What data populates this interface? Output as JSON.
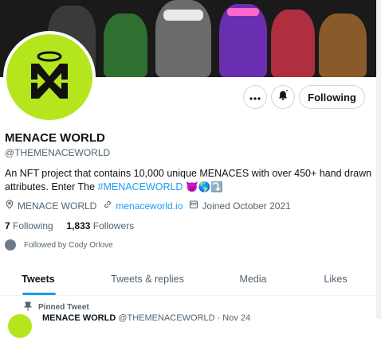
{
  "profile": {
    "name": "MENACE WORLD",
    "handle": "@THEMENACEWORLD",
    "bio_text": "An NFT project that contains 10,000 unique MENACES with over 450+ hand drawn attributes. Enter The ",
    "bio_hashtag": "#MENACEWORLD",
    "bio_emojis": "😈🌎⤵️",
    "location": "MENACE WORLD",
    "website": "menaceworld.io",
    "joined": "Joined October 2021",
    "following_count": "7",
    "following_label": "Following",
    "followers_count": "1,833",
    "followers_label": "Followers",
    "followed_by": "Followed by Cody Orlove",
    "brand_color": "#b5e61d",
    "accent_color": "#1d9bf0"
  },
  "actions": {
    "more_icon": "more-icon",
    "notify_icon": "bell-icon",
    "follow_label": "Following"
  },
  "tabs": [
    {
      "label": "Tweets",
      "active": true
    },
    {
      "label": "Tweets & replies",
      "active": false
    },
    {
      "label": "Media",
      "active": false
    },
    {
      "label": "Likes",
      "active": false
    }
  ],
  "pinned": {
    "label": "Pinned Tweet",
    "author": "MENACE WORLD",
    "handle_date": "@THEMENACEWORLD · Nov 24"
  }
}
